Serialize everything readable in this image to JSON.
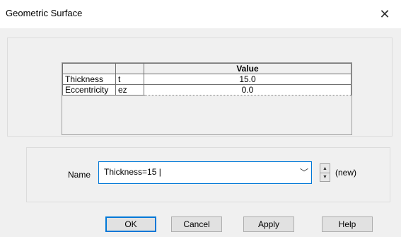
{
  "window": {
    "title": "Geometric Surface",
    "close_icon": "close-icon"
  },
  "table": {
    "header": {
      "value": "Value"
    },
    "rows": [
      {
        "name": "Thickness",
        "symbol": "t",
        "value": "15.0"
      },
      {
        "name": "Eccentricity",
        "symbol": "ez",
        "value": "0.0"
      }
    ]
  },
  "name_field": {
    "label": "Name",
    "value": "Thickness=15 |",
    "status": "(new)"
  },
  "buttons": {
    "ok": "OK",
    "cancel": "Cancel",
    "apply": "Apply",
    "help": "Help"
  }
}
